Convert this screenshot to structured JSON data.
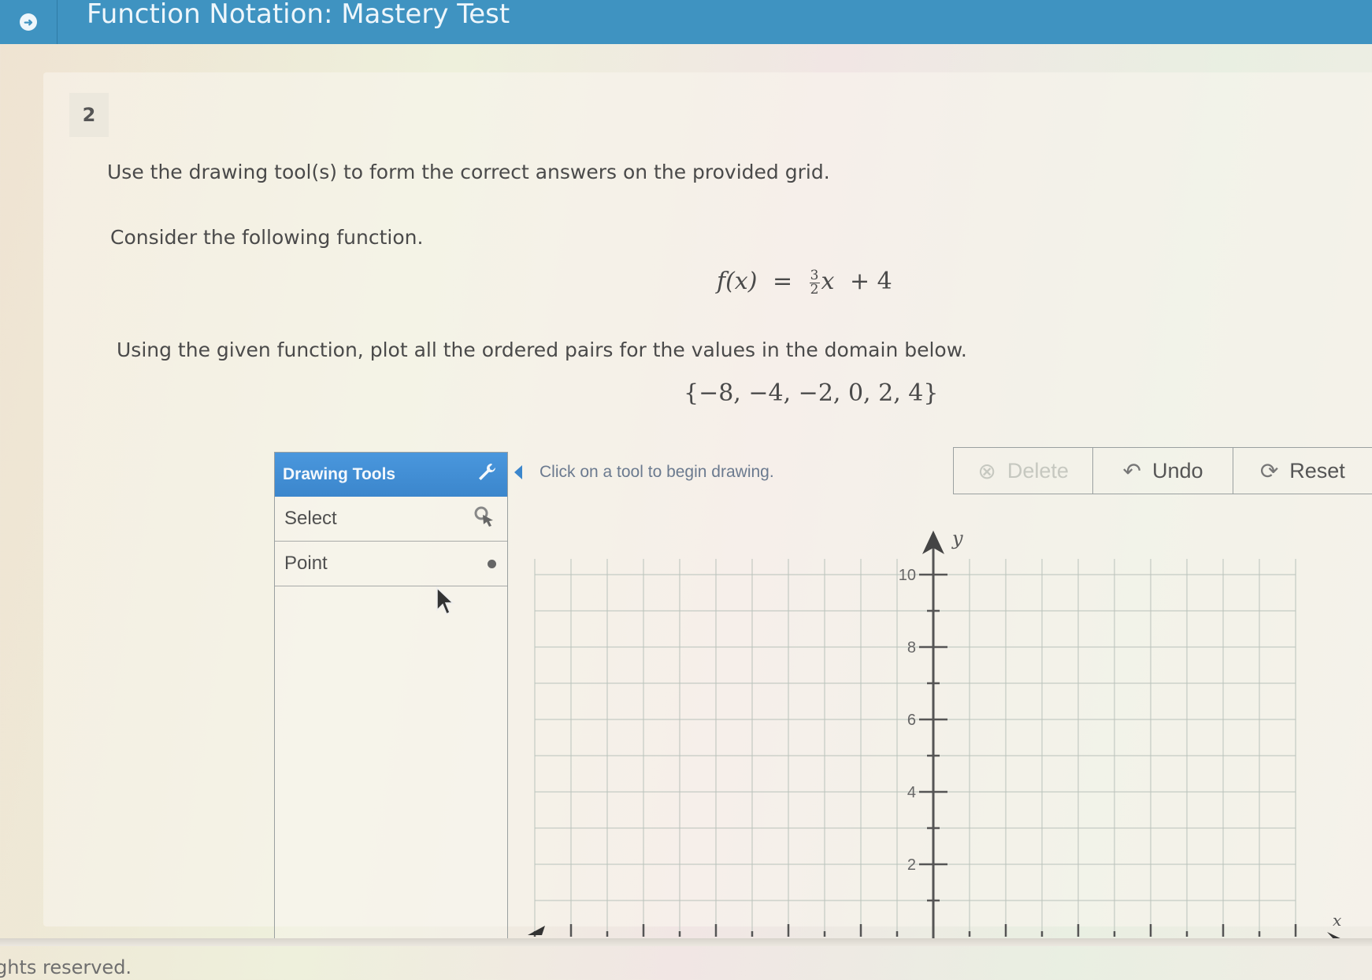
{
  "header": {
    "title": "Function Notation: Mastery Test",
    "nav_icon": "arrow-right-circle-icon"
  },
  "question": {
    "number": "2",
    "instruction": "Use the drawing tool(s) to form the correct answers on the provided grid.",
    "prompt": "Consider the following function.",
    "function": {
      "lhs": "f(x)",
      "equals": "=",
      "coef_num": "3",
      "coef_den": "2",
      "var": "x",
      "rest": "+ 4"
    },
    "task": "Using the given function, plot all the ordered pairs for the values in the domain below.",
    "domain": "{−8, −4, −2, 0, 2, 4}"
  },
  "tools": {
    "header_label": "Drawing Tools",
    "header_icon": "wrench-icon",
    "items": [
      {
        "label": "Select",
        "icon": "select-cursor-icon"
      },
      {
        "label": "Point",
        "icon": "point-dot-icon"
      }
    ]
  },
  "message": "Click on a tool to begin drawing.",
  "actions": {
    "delete": {
      "label": "Delete",
      "icon": "delete-circle-icon",
      "enabled": false
    },
    "undo": {
      "label": "Undo",
      "icon": "undo-arrow-icon",
      "enabled": true
    },
    "reset": {
      "label": "Reset",
      "icon": "reset-refresh-icon",
      "enabled": true
    }
  },
  "graph": {
    "x_axis_label": "x",
    "y_axis_label": "y",
    "y_tick_labels": [
      "10",
      "8",
      "6",
      "4",
      "2"
    ],
    "y_tick_values": [
      10,
      8,
      6,
      4,
      2
    ],
    "x_visible_range": [
      -11,
      11
    ],
    "y_visible_range": [
      0,
      11
    ],
    "plotted_points": []
  },
  "footer": {
    "text": "ghts reserved."
  }
}
